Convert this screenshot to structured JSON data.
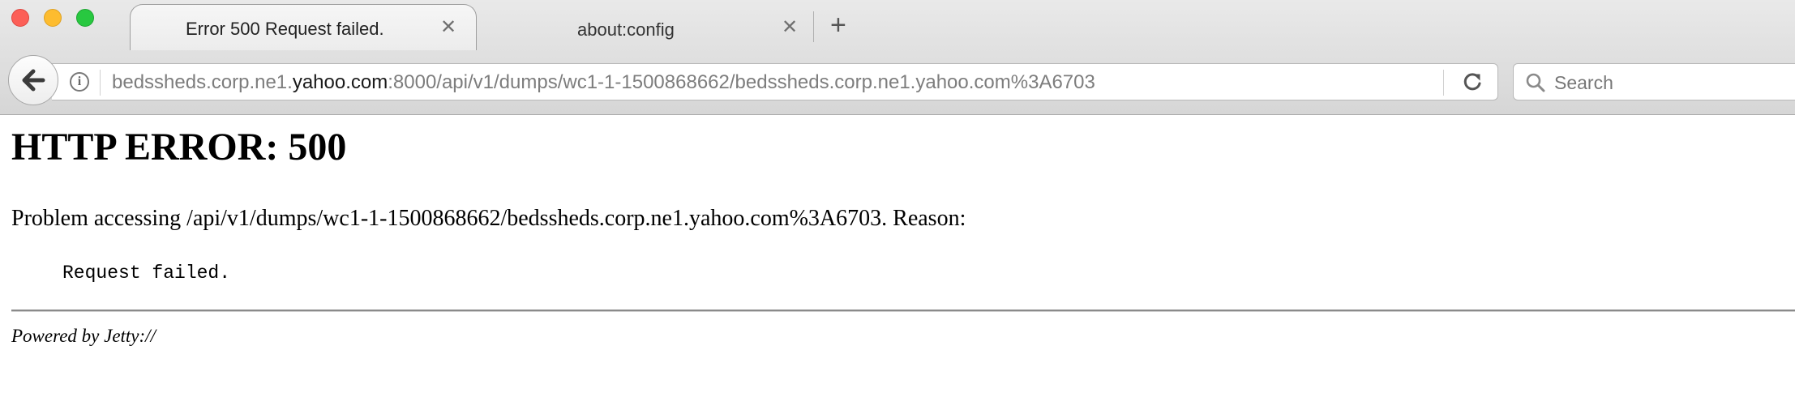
{
  "window": {
    "buttons": [
      "close",
      "minimize",
      "zoom"
    ]
  },
  "tabs": [
    {
      "title": "Error 500 Request failed.",
      "active": true
    },
    {
      "title": "about:config",
      "active": false
    }
  ],
  "new_tab_label": "+",
  "tab_close_glyph": "✕",
  "navigation": {
    "back_icon": "back-arrow-icon",
    "info_icon": "i",
    "url": {
      "prefix": "bedssheds.corp.ne1.",
      "host": "yahoo.com",
      "suffix": ":8000/api/v1/dumps/wc1-1-1500868662/bedssheds.corp.ne1.yahoo.com%3A6703"
    },
    "reload_icon": "reload-icon",
    "search_placeholder": "Search"
  },
  "page": {
    "heading": "HTTP ERROR: 500",
    "problem": "Problem accessing /api/v1/dumps/wc1-1-1500868662/bedssheds.corp.ne1.yahoo.com%3A6703. Reason:",
    "reason": "Request failed.",
    "footer": "Powered by Jetty://"
  },
  "colors": {
    "traffic_red": "#fc5f57",
    "traffic_yellow": "#fdbc2f",
    "traffic_green": "#28c840",
    "url_host": "#1a1a1a",
    "url_dim": "#7d7d7d"
  }
}
